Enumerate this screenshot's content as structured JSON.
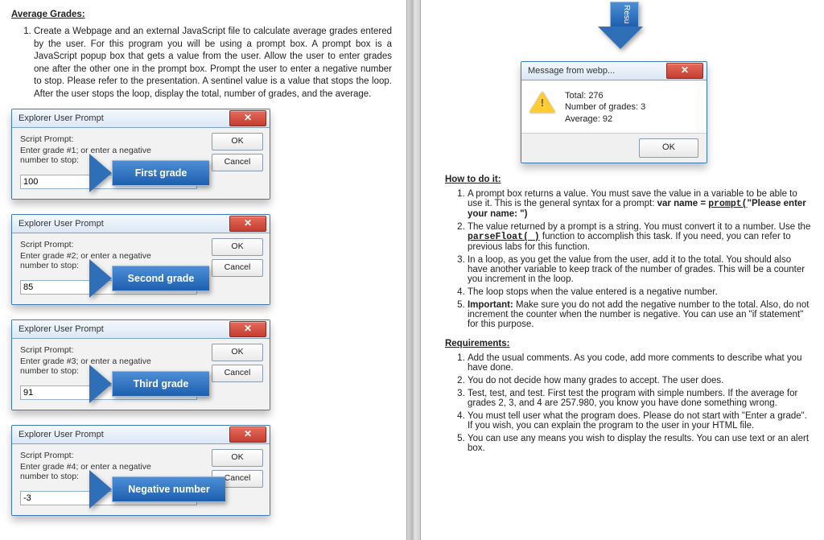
{
  "left": {
    "heading": "Average Grades:",
    "intro": "Create a Webpage and an external JavaScript file to calculate average grades entered by the user. For this program you will be using a prompt box. A prompt box is a JavaScript popup box that gets a value from the user. Allow the user to enter grades one after the other one in the prompt box. Prompt the user to enter a negative number to stop. Please refer to the presentation. A sentinel value is a value that stops the loop. After the user stops the loop, display the total, number of grades, and the average.",
    "dialog_title": "Explorer User Prompt",
    "close_glyph": "✕",
    "ok_label": "OK",
    "cancel_label": "Cancel",
    "script_prompt_label": "Script Prompt:",
    "prompts": [
      {
        "text": "Enter grade #1; or enter a negative number to stop:",
        "value": "100",
        "arrow": "First grade"
      },
      {
        "text": "Enter grade #2; or enter a negative number to stop:",
        "value": "85",
        "arrow": "Second grade"
      },
      {
        "text": "Enter grade #3; or enter a negative number to stop:",
        "value": "91",
        "arrow": "Third grade"
      },
      {
        "text": "Enter grade #4; or enter a negative number to stop:",
        "value": "-3",
        "arrow": "Negative number"
      }
    ]
  },
  "right": {
    "big_arrow_label": "Resu",
    "msgbox_title": "Message from webp...",
    "msgbox_lines": {
      "l1": "Total: 276",
      "l2": "Number of grades: 3",
      "l3": "Average: 92"
    },
    "ok_label": "OK",
    "howto_heading": "How to do it:",
    "howto": {
      "i1a": "A prompt box returns a value. You must save the value in a variable to be able to use it. This is the general syntax for a prompt: ",
      "i1b": "var name = ",
      "i1c": "prompt(",
      "i1d": "\"Please enter your name: \")",
      "i2a": "The value returned by a prompt is a string. You must convert it to a number. Use the ",
      "i2b": "parseFloat( )",
      "i2c": " function to accomplish this task. If you need, you can refer to previous labs for this function.",
      "i3": "In a loop, as you get the value from the user, add it to the total. You should also have another variable to keep track of the number of grades. This will be a counter you increment in the loop.",
      "i4": "The loop stops when the value entered is a negative number.",
      "i5a": "Important:",
      "i5b": " Make sure you do not add the negative number to the total. Also, do not increment the counter when the number is negative. You can use an \"if statement\" for this purpose."
    },
    "req_heading": "Requirements:",
    "reqs": {
      "r1": "Add the usual comments. As you code, add more comments to describe what you have done.",
      "r2": "You do not decide how many grades to accept. The user does.",
      "r3": "Test, test, and test. First test the program with simple numbers. If the average for grades 2, 3, and 4 are 257.980, you know you have done something wrong.",
      "r4": "You must tell user what the program does. Please do not start with \"Enter a grade\". If you wish, you can explain the program to the user in your HTML file.",
      "r5": "You can use any means you wish to display the results. You can use text or an alert box."
    }
  }
}
